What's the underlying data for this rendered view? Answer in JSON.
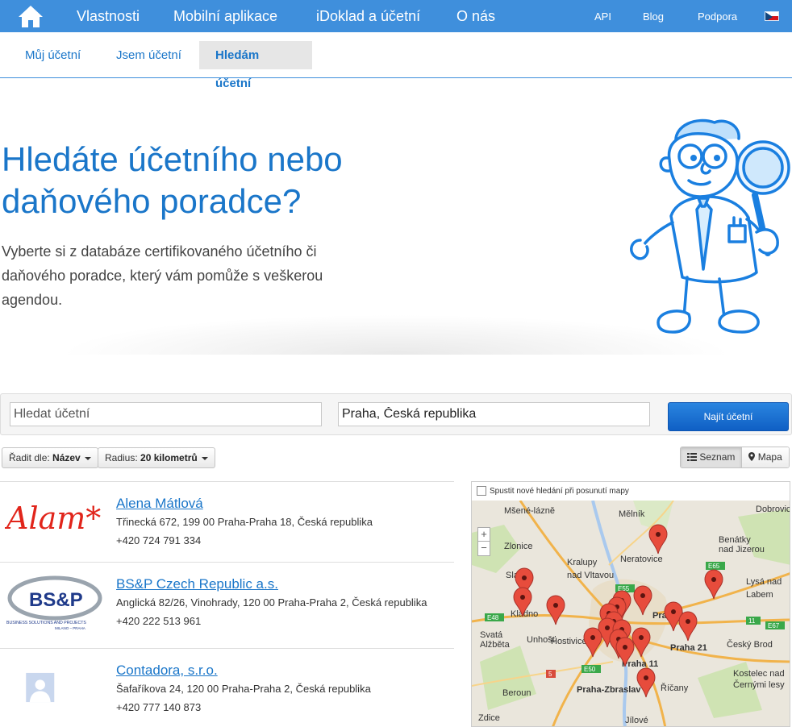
{
  "nav": {
    "items": [
      "Vlastnosti",
      "Mobilní aplikace",
      "iDoklad a účetní",
      "O nás"
    ],
    "right": [
      "API",
      "Blog",
      "Podpora"
    ]
  },
  "subnav": [
    "Můj účetní",
    "Jsem účetní",
    "Hledám účetní"
  ],
  "hero": {
    "title": "Hledáte účetního nebo daňového poradce?",
    "text": "Vyberte si z databáze certifikovaného účetního či daňového poradce, který vám pomůže s veškerou agendou."
  },
  "search": {
    "name_placeholder": "Hledat účetní",
    "location_value": "Praha, Česká republika",
    "button": "Najít účetní"
  },
  "filters": {
    "sort_label": "Řadit dle:",
    "sort_value": "Název",
    "radius_label": "Radius:",
    "radius_value": "20 kilometrů"
  },
  "view_toggle": {
    "list": "Seznam",
    "map": "Mapa",
    "active": "list"
  },
  "results": [
    {
      "name": "Alena Mátlová",
      "address": "Třinecká 672, 199 00 Praha-Praha 18, Česká republika",
      "phone": "+420 724 791 334",
      "logo": "Alam*"
    },
    {
      "name": "BS&P Czech Republic a.s.",
      "address": "Anglická 82/26, Vinohrady, 120 00 Praha-Praha 2, Česká republika",
      "phone": "+420 222 513 961",
      "logo": "BS&P",
      "logo_tagline": "BUSINESS SOLUTIONS AND PROJECTS",
      "logo_subtag": "MILANO – PRAHA"
    },
    {
      "name": "Contadora, s.r.o.",
      "address": "Šafaříkova 24, 120 00 Praha-Praha 2, Česká republika",
      "phone": "+420 777 140 873",
      "logo": "avatar-placeholder"
    }
  ],
  "map": {
    "checkbox_label": "Spustit nové hledání při posunutí mapy",
    "zoom_in": "+",
    "zoom_out": "−",
    "places": [
      "Mšené-lázně",
      "Mělník",
      "Dobrovic",
      "Zlonice",
      "Benátky nad Jizerou",
      "Kralupy nad Vltavou",
      "Neratovice",
      "Slaný",
      "Lysá nad Labem",
      "Kladno",
      "Praha 18",
      "Praha 21",
      "Český Brod",
      "Svatá Alžběta",
      "Unhošť",
      "Hostivice",
      "Praha 11",
      "Kostelec nad Černými lesy",
      "Beroun",
      "Praha-Zbraslav",
      "Říčany",
      "Zdice",
      "Jílové"
    ],
    "roads": [
      "E55",
      "E65",
      "E48",
      "E50",
      "E67",
      "11",
      "5"
    ]
  },
  "colors": {
    "brand": "#3f8fdc",
    "link": "#1a76c9",
    "button": "#1f72d6",
    "pin": "#e74c3c"
  }
}
